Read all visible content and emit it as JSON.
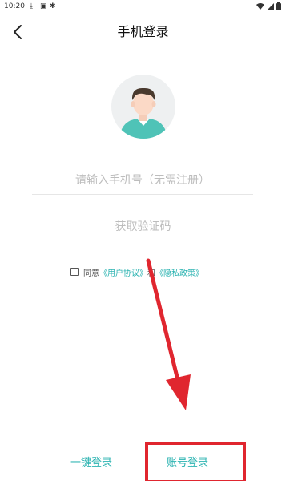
{
  "status_bar": {
    "time": "10:20",
    "icons": [
      "download-icon",
      "notification-a-icon",
      "bug-icon",
      "wifi-icon",
      "signal-icon",
      "battery-icon"
    ]
  },
  "header": {
    "title": "手机登录",
    "back_icon": "back-arrow-icon"
  },
  "avatar": {
    "icon": "user-avatar-icon"
  },
  "phone_input": {
    "placeholder": "请输入手机号（无需注册）",
    "value": ""
  },
  "get_code": {
    "label": "获取验证码"
  },
  "agreement": {
    "checked": false,
    "prefix": "同意",
    "user_agreement": "《用户协议》",
    "and": "和",
    "privacy_policy": "《隐私政策》"
  },
  "bottom": {
    "one_key_login": "一键登录",
    "account_login": "账号登录"
  },
  "colors": {
    "accent": "#2bb3b1",
    "annotation_red": "#e0262f",
    "placeholder_gray": "#bdbdbd"
  }
}
